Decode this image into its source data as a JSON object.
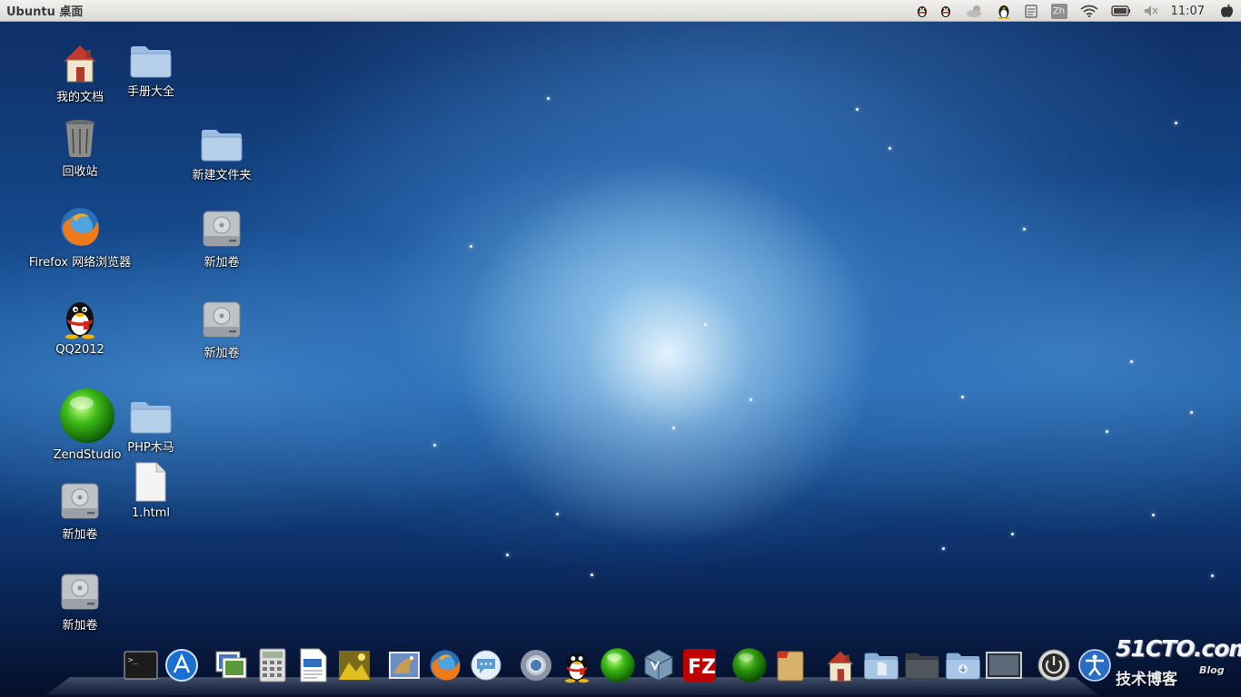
{
  "top_panel": {
    "title": "Ubuntu 桌面",
    "tray": {
      "qq_icon_1": "qq-penguin-icon",
      "qq_icon_2": "qq-penguin-icon",
      "input_method": "Zh",
      "clock": "11:07"
    }
  },
  "desktop": {
    "icons": [
      {
        "label": "我的文档",
        "icon": "home-icon"
      },
      {
        "label": "手册大全",
        "icon": "folder-icon"
      },
      {
        "label": "回收站",
        "icon": "trash-icon"
      },
      {
        "label": "新建文件夹",
        "icon": "folder-icon"
      },
      {
        "label": "Firefox 网络浏览器",
        "icon": "firefox-icon"
      },
      {
        "label": "新加卷",
        "icon": "drive-icon"
      },
      {
        "label": "QQ2012",
        "icon": "qq-penguin-icon"
      },
      {
        "label": "新加卷",
        "icon": "drive-icon"
      },
      {
        "label": "ZendStudio",
        "icon": "green-orb-icon"
      },
      {
        "label": "PHP木马",
        "icon": "folder-icon"
      },
      {
        "label": "新加卷",
        "icon": "drive-icon"
      },
      {
        "label": "1.html",
        "icon": "file-icon"
      },
      {
        "label": "新加卷",
        "icon": "drive-icon"
      }
    ]
  },
  "dock": {
    "items": [
      "terminal-icon",
      "app-store-icon",
      "image-viewer-icon",
      "calculator-icon",
      "document-editor-icon",
      "photo-manager-icon",
      "mail-icon",
      "firefox-icon",
      "chat-icon",
      "chrome-icon",
      "qq-penguin-icon",
      "zend-studio-icon",
      "virtualbox-icon",
      "filezilla-icon",
      "green-orb-icon",
      "notes-icon",
      "home-icon",
      "documents-folder-icon",
      "dark-folder-icon",
      "downloads-folder-icon",
      "workspace-icon",
      "power-icon",
      "accessibility-icon"
    ]
  },
  "watermark": {
    "site": "51CTO.com",
    "subtitle": "技术博客",
    "blog": "Blog"
  }
}
